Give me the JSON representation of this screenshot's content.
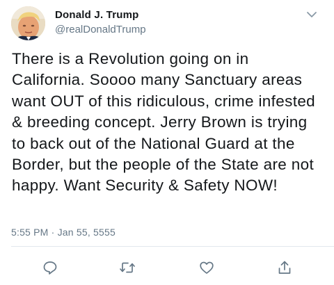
{
  "tweet": {
    "author_name": "Donald J. Trump",
    "author_handle": "@realDonaldTrump",
    "text": "There is a Revolution going on in California. Soooo many Sanctuary areas want OUT of this ridiculous, crime infested & breeding concept. Jerry Brown is trying to back out of the National Guard at the Border, but the people of the State are not happy. Want Security & Safety NOW!",
    "timestamp": "5:55 PM · Jan 55, 5555"
  },
  "icons": {
    "menu": "chevron-down-icon",
    "reply": "reply-icon",
    "retweet": "retweet-icon",
    "like": "heart-icon",
    "share": "share-icon"
  },
  "colors": {
    "text_primary": "#14171a",
    "text_secondary": "#657786",
    "icon": "#657786",
    "divider": "#e1e8ed"
  }
}
